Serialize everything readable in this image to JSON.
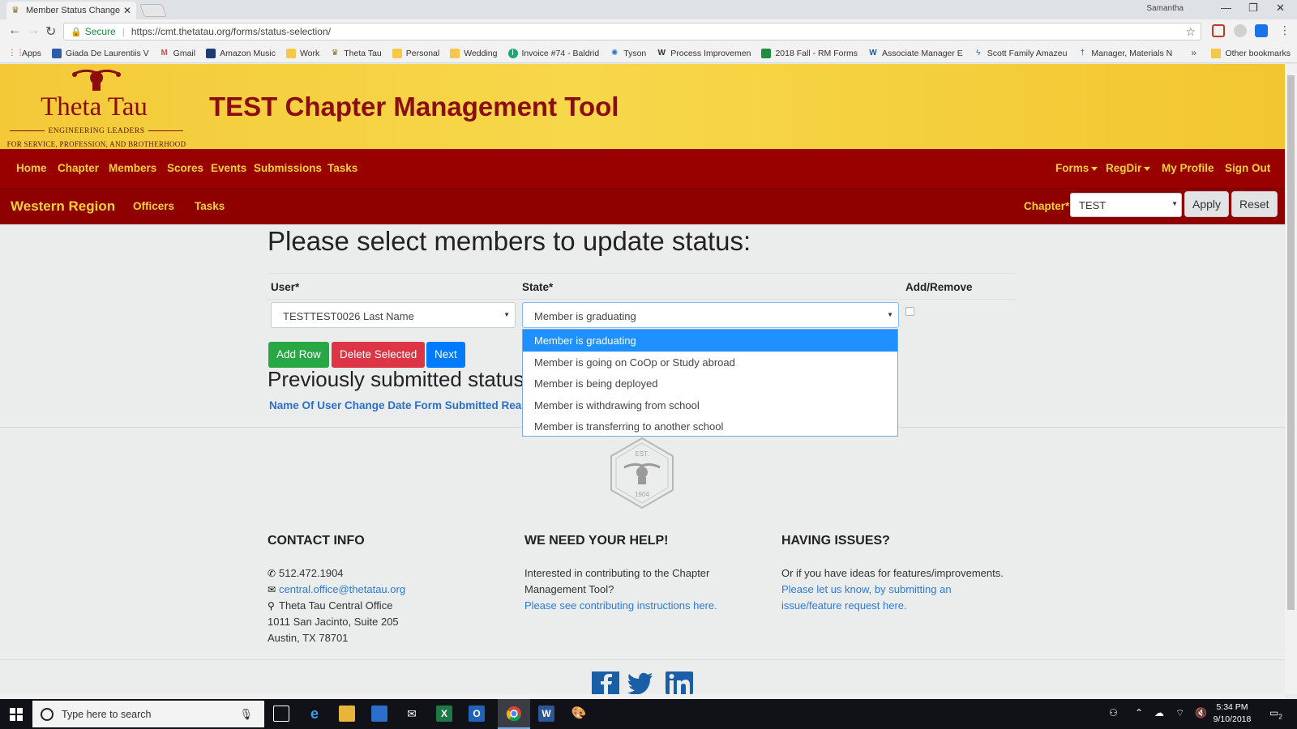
{
  "browser": {
    "tab_title": "Member Status Change R",
    "user": "Samantha",
    "secure_label": "Secure",
    "url": "https://cmt.thetatau.org/forms/status-selection/",
    "bookmarks": [
      "Apps",
      "Giada De Laurentiis V",
      "Gmail",
      "Amazon Music",
      "Work",
      "Theta Tau",
      "Personal",
      "Wedding",
      "Invoice #74 - Baldrid",
      "Tyson",
      "Process Improvemen",
      "2018 Fall - RM Forms",
      "Associate Manager E",
      "Scott Family Amazeu",
      "Manager, Materials N"
    ],
    "other_bookmarks": "Other bookmarks"
  },
  "header": {
    "logo_name": "Theta Tau",
    "logo_tag1": "ENGINEERING LEADERS",
    "logo_tag2": "FOR SERVICE, PROFESSION, AND BROTHERHOOD",
    "title": "TEST Chapter Management Tool"
  },
  "nav": {
    "left": [
      "Home",
      "Chapter",
      "Members",
      "Scores",
      "Events",
      "Submissions",
      "Tasks"
    ],
    "forms": "Forms",
    "regdir": "RegDir",
    "profile": "My Profile",
    "signout": "Sign Out"
  },
  "subnav": {
    "region": "Western Region",
    "officers": "Officers",
    "tasks": "Tasks",
    "chapter_label": "Chapter*",
    "chapter_value": "TEST",
    "apply": "Apply",
    "reset": "Reset"
  },
  "form": {
    "heading": "Please select members to update status:",
    "col_user": "User*",
    "col_state": "State*",
    "col_addremove": "Add/Remove",
    "user_value": "TESTTEST0026 Last Name",
    "state_value": "Member is graduating",
    "add_row": "Add Row",
    "delete_selected": "Delete Selected",
    "next": "Next",
    "state_options": [
      "Member is graduating",
      "Member is going on CoOp or Study abroad",
      "Member is being deployed",
      "Member is withdrawing from school",
      "Member is transferring to another school"
    ]
  },
  "previous": {
    "heading": "Previously submitted statuses",
    "columns": "Name Of User Change Date Form Submitted Reason"
  },
  "emblem": {
    "est": "EST.",
    "year": "1904"
  },
  "footer": {
    "contact_title": "CONTACT INFO",
    "phone": "512.472.1904",
    "email": "central.office@thetatau.org",
    "office": "Theta Tau Central Office",
    "address1": "1011 San Jacinto, Suite 205",
    "address2": "Austin, TX 78701",
    "help_title": "WE NEED YOUR HELP!",
    "help_text1": "Interested in contributing to the Chapter",
    "help_text2": "Management Tool?",
    "help_link": "Please see contributing instructions here.",
    "issues_title": "HAVING ISSUES?",
    "issues_text": "Or if you have ideas for features/improvements.",
    "issues_link1": "Please let us know, by submitting an",
    "issues_link2": "issue/feature request here."
  },
  "taskbar": {
    "search_placeholder": "Type here to search",
    "time": "5:34 PM",
    "date": "9/10/2018",
    "notifications": "2"
  }
}
